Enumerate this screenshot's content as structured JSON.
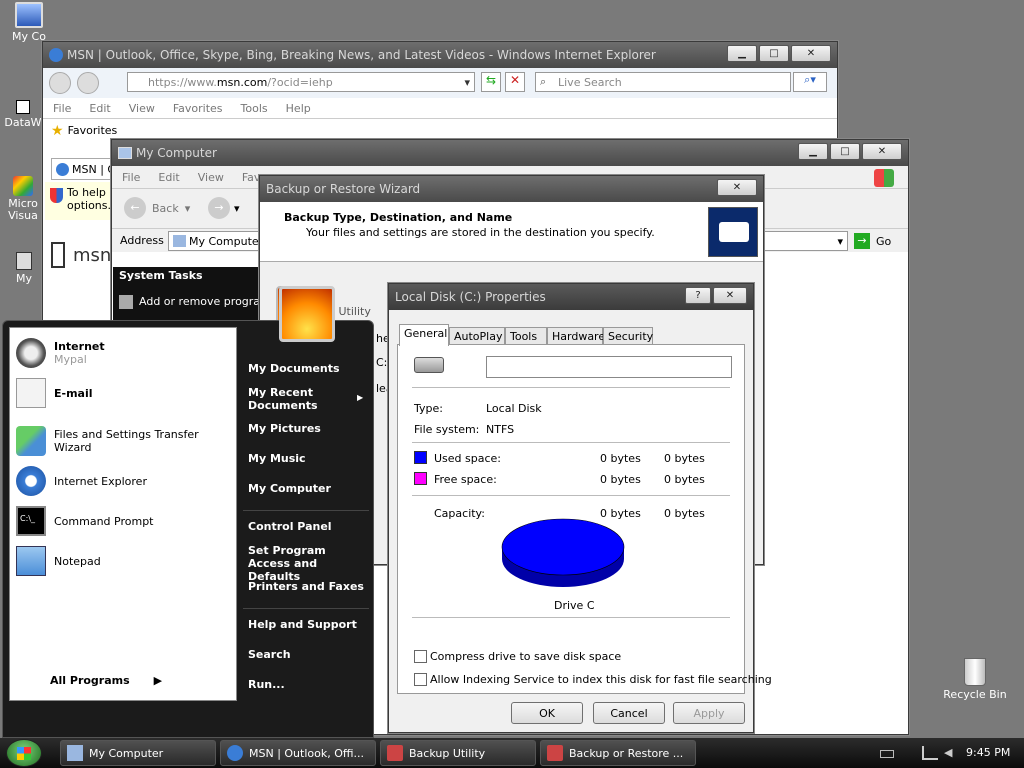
{
  "desktop": {
    "icons": [
      {
        "label": "My Co"
      },
      {
        "label": "DataW"
      },
      {
        "label": "Micro Visua"
      },
      {
        "label": "My"
      },
      {
        "label": "Recycle Bin"
      }
    ]
  },
  "ie": {
    "title": "MSN | Outlook, Office, Skype, Bing, Breaking News, and Latest Videos - Windows Internet Explorer",
    "address_prefix": "https://www.",
    "address_domain": "msn.com",
    "address_suffix": "/?ocid=iehp",
    "search_placeholder": "Live Search",
    "menu": [
      "File",
      "Edit",
      "View",
      "Favorites",
      "Tools",
      "Help"
    ],
    "favorites_label": "Favorites",
    "tab_label": "MSN | O",
    "infobar_line1": "To help p",
    "infobar_line2": "options.",
    "msn_logo": "msn"
  },
  "mycomputer": {
    "title": "My Computer",
    "menu": [
      "File",
      "Edit",
      "View",
      "Favo",
      "",
      "T"
    ],
    "back_label": "Back",
    "address_label": "Address",
    "address_value": "My Computer",
    "go_label": "Go",
    "system_tasks": "System Tasks",
    "task1": "Add or remove program"
  },
  "backup": {
    "title": "Backup or Restore Wizard",
    "heading": "Backup Type, Destination, and Name",
    "subheading": "Your files and settings are stored in the destination you specify.",
    "util_label": "p Utility",
    "frag1": "he",
    "frag2": "C:\\",
    "frag3": "lea"
  },
  "props": {
    "title": "Local Disk (C:) Properties",
    "tabs": [
      "General",
      "AutoPlay",
      "Tools",
      "Hardware",
      "Security"
    ],
    "name_value": "",
    "type_label": "Type:",
    "type_value": "Local Disk",
    "fs_label": "File system:",
    "fs_value": "NTFS",
    "used_label": "Used space:",
    "used_bytes": "0 bytes",
    "used_bytes2": "0 bytes",
    "free_label": "Free space:",
    "free_bytes": "0 bytes",
    "free_bytes2": "0 bytes",
    "cap_label": "Capacity:",
    "cap_bytes": "0 bytes",
    "cap_bytes2": "0 bytes",
    "drive_label": "Drive C",
    "compress_label": "Compress drive to save disk space",
    "index_label": "Allow Indexing Service to index this disk for fast file searching",
    "ok": "OK",
    "cancel": "Cancel",
    "apply": "Apply",
    "used_color": "#0000ff",
    "free_color": "#ff00ff"
  },
  "startmenu": {
    "left": [
      {
        "label": "Internet",
        "sub": "Mypal"
      },
      {
        "label": "E-mail"
      },
      {
        "label": "Files and Settings Transfer Wizard"
      },
      {
        "label": "Internet Explorer"
      },
      {
        "label": "Command Prompt"
      },
      {
        "label": "Notepad"
      }
    ],
    "all_programs": "All Programs",
    "right": [
      "My Documents",
      "My Recent Documents",
      "My Pictures",
      "My Music",
      "My Computer",
      "Control Panel",
      "Set Program Access and Defaults",
      "Printers and Faxes",
      "Help and Support",
      "Search",
      "Run..."
    ]
  },
  "taskbar": {
    "buttons": [
      "My Computer",
      "MSN | Outlook, Offi...",
      "Backup Utility",
      "Backup or Restore ..."
    ],
    "clock": "9:45 PM"
  }
}
